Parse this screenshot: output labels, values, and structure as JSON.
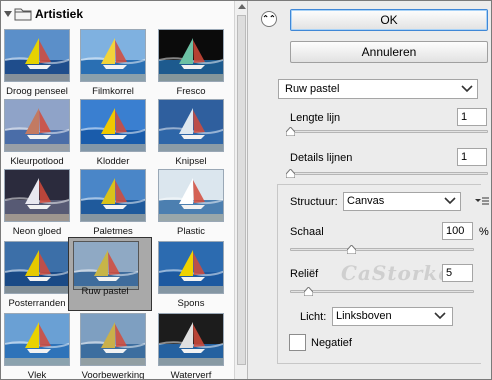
{
  "gallery": {
    "category": "Artistiek",
    "items": [
      {
        "label": "Droog penseel",
        "sky": "#5b8fc9",
        "sea": "#1f4d8c",
        "sail": "#e6d200"
      },
      {
        "label": "Filmkorrel",
        "sky": "#7fb1e0",
        "sea": "#2a6fb3",
        "sail": "#f2d43a"
      },
      {
        "label": "Fresco",
        "sky": "#0b0b0b",
        "sea": "#1d5a8e",
        "sail": "#6cc1a4"
      },
      {
        "label": "Kleurpotlood",
        "sky": "#8fa3c8",
        "sea": "#4a6da8",
        "sail": "#c27a62"
      },
      {
        "label": "Klodder",
        "sky": "#3a7fd0",
        "sea": "#1a5cab",
        "sail": "#f0c800"
      },
      {
        "label": "Knipsel",
        "sky": "#2f5f9e",
        "sea": "#2e66a8",
        "sail": "#dfe8ef"
      },
      {
        "label": "Neon gloed",
        "sky": "#2b2b3d",
        "sea": "#575a74",
        "sail": "#e8e8f0"
      },
      {
        "label": "Paletmes",
        "sky": "#4a86c8",
        "sea": "#1f5a9c",
        "sail": "#d9c21a"
      },
      {
        "label": "Plastic",
        "sky": "#dbe6ee",
        "sea": "#4c7fb0",
        "sail": "#ffffff"
      },
      {
        "label": "Posterranden",
        "sky": "#3c6fa8",
        "sea": "#1a4a86",
        "sail": "#e5c900"
      },
      {
        "label": "Ruw pastel",
        "sky": "#8fa9c4",
        "sea": "#3e6c9c",
        "sail": "#c7b548",
        "selected": true
      },
      {
        "label": "Spons",
        "sky": "#2c6bb0",
        "sea": "#1d59a0",
        "sail": "#efd200"
      },
      {
        "label": "Vlek",
        "sky": "#6aa0d4",
        "sea": "#2e73b9",
        "sail": "#e9d200"
      },
      {
        "label": "Voorbewerking",
        "sky": "#7e9fc1",
        "sea": "#3d6e9f",
        "sail": "#c9b04a"
      },
      {
        "label": "Waterverf",
        "sky": "#1c1c1c",
        "sea": "#2461a0",
        "sail": "#e0e0e0"
      }
    ]
  },
  "dialog": {
    "collapse_glyph": "⌃⌃",
    "ok": "OK",
    "cancel": "Annuleren",
    "filter": "Ruw pastel"
  },
  "params": {
    "stroke_length": {
      "label": "Lengte lijn",
      "value": "1",
      "level": 0.0
    },
    "stroke_detail": {
      "label": "Details lijnen",
      "value": "1",
      "level": 0.0
    },
    "texture": {
      "label": "Structuur:",
      "value": "Canvas"
    },
    "scaling": {
      "label": "Schaal",
      "value": "100",
      "unit": "%",
      "level": 0.33
    },
    "relief": {
      "label": "Reliëf",
      "value": "5",
      "level": 0.1
    },
    "light": {
      "label": "Licht:",
      "value": "Linksboven"
    },
    "invert": {
      "label": "Negatief",
      "checked": false
    }
  },
  "watermark": "CaStorke",
  "colors": {
    "accent": "#3f87d6",
    "selection": "#a9a9a9"
  }
}
